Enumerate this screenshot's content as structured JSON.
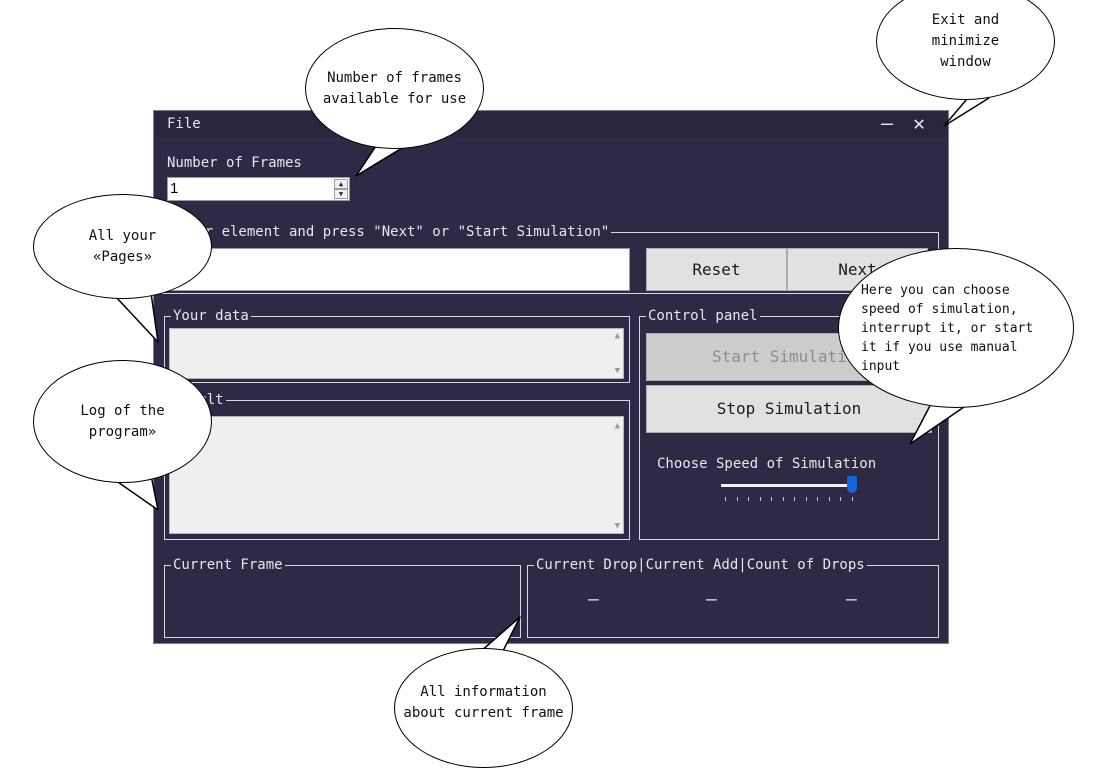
{
  "window": {
    "menu_file": "File",
    "minimize_glyph": "—",
    "close_glyph": "✕",
    "frames_label": "Number of Frames",
    "frames_value": "1",
    "enter_legend": "Enter element and press \"Next\" or \"Start Simulation\"",
    "reset_label": "Reset",
    "next_label": "Next",
    "your_data_legend": "Your data",
    "result_legend": "Result",
    "control_legend": "Control panel",
    "start_label": "Start Simulation",
    "stop_label": "Stop Simulation",
    "speed_label": "Choose Speed of Simulation",
    "speed_value": 1.0,
    "current_frame_legend": "Current Frame",
    "drop_legend": "Current Drop|Current Add|Count of Drops",
    "drop_value": "–",
    "add_value": "–",
    "count_value": "–"
  },
  "icons": {
    "scroll_up": "▲",
    "scroll_down": "▼",
    "spin_up": "▲",
    "spin_down": "▼"
  },
  "callouts": {
    "exit": "Exit and minimize window",
    "frames": "Number of frames available for use",
    "pages": "All your «Pages»",
    "log": "Log of the program»",
    "speed": "Here you can choose speed of simulation, interrupt it, or start it if you use manual input",
    "frame_info": "All information about current frame"
  },
  "colors": {
    "window_bg": "#2e2a46",
    "slider_thumb": "#1565d8"
  }
}
